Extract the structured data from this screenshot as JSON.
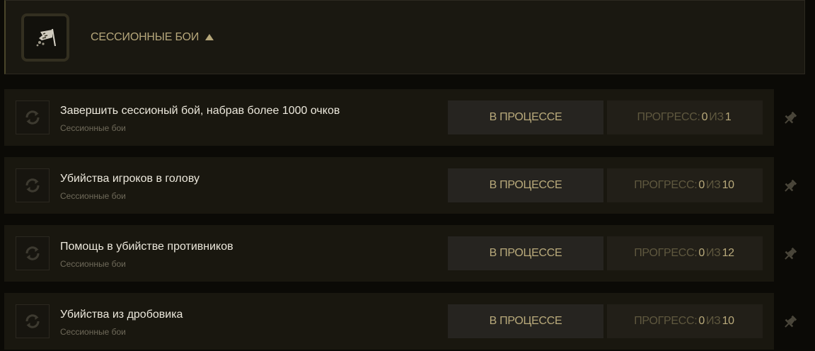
{
  "category": {
    "title": "СЕССИОННЫЕ БОИ",
    "icon": "battle-flag-icon",
    "caret": "caret-up-icon"
  },
  "colors": {
    "accent": "#b9aa7b",
    "text": "#ece8dc",
    "muted": "#6f6a5a",
    "card": "#19170f",
    "background": "#0b0a06"
  },
  "quests": [
    {
      "title": "Завершить сессионый бой, набрав более 1000 очков",
      "category": "Сессионные бои",
      "status": "В ПРОЦЕССЕ",
      "progress_label": "ПРОГРЕСС:",
      "progress_current": "0",
      "progress_of": "ИЗ",
      "progress_total": "1",
      "icon": "refresh-icon",
      "pin_icon": "pin-icon"
    },
    {
      "title": "Убийства игроков в голову",
      "category": "Сессионные бои",
      "status": "В ПРОЦЕССЕ",
      "progress_label": "ПРОГРЕСС:",
      "progress_current": "0",
      "progress_of": "ИЗ",
      "progress_total": "10",
      "icon": "refresh-icon",
      "pin_icon": "pin-icon"
    },
    {
      "title": "Помощь в убийстве противников",
      "category": "Сессионные бои",
      "status": "В ПРОЦЕССЕ",
      "progress_label": "ПРОГРЕСС:",
      "progress_current": "0",
      "progress_of": "ИЗ",
      "progress_total": "12",
      "icon": "refresh-icon",
      "pin_icon": "pin-icon"
    },
    {
      "title": "Убийства из дробовика",
      "category": "Сессионные бои",
      "status": "В ПРОЦЕССЕ",
      "progress_label": "ПРОГРЕСС:",
      "progress_current": "0",
      "progress_of": "ИЗ",
      "progress_total": "10",
      "icon": "refresh-icon",
      "pin_icon": "pin-icon"
    }
  ]
}
